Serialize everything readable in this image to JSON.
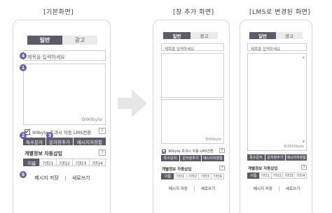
{
  "captions": {
    "basic": "[기본화면]",
    "window_add": "[창 추가 화면]",
    "lms_change": "[LMS로 변경된 화면]"
  },
  "tabs": {
    "general": "일반",
    "ad": "광고"
  },
  "title_placeholder": "제목을 입력하세요",
  "counter": {
    "sms_used": "0",
    "sms_max": "/90byte",
    "lms_used": "0",
    "lms_max": "/2000byte"
  },
  "check_label": "90byte 초과시 자동 LMS전환",
  "help_label": "?",
  "buttons": {
    "special_char": "특수문자",
    "add_window": "문자창추가",
    "saved_messages": "메시지저장함"
  },
  "personal_info_title": "개별정보 자동삽입",
  "personal_tabs": [
    "이름",
    "기타1",
    "기타2",
    "기타3",
    "기타4"
  ],
  "bottom": {
    "save": "메시지 저장",
    "refresh": "새로쓰기"
  },
  "badges": [
    "1",
    "2",
    "3",
    "4",
    "5"
  ],
  "colors": {
    "dark_button": "#5b5b6a",
    "badge": "#6b5fae",
    "counter_accent": "#e2405a"
  }
}
